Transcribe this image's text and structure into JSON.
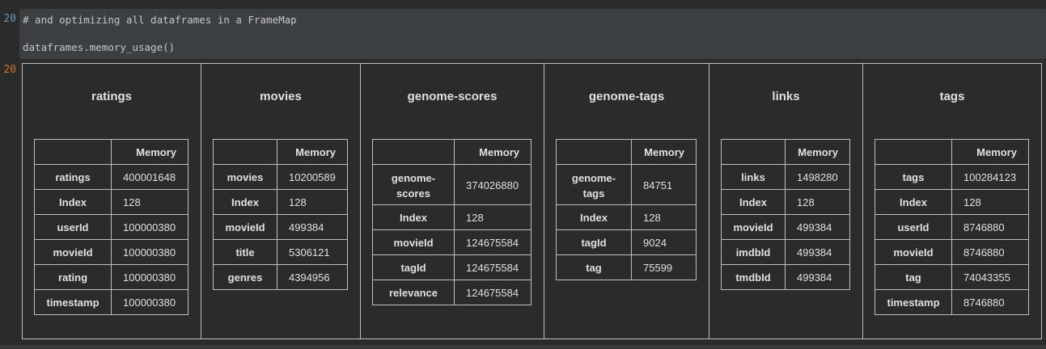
{
  "cell": {
    "in_prompt": "20",
    "out_prompt": "20",
    "code_lines": [
      "# and optimizing all dataframes in a FrameMap",
      "",
      "dataframes.memory_usage()"
    ]
  },
  "output": {
    "frames": [
      {
        "title": "ratings",
        "header": "Memory",
        "rows": [
          {
            "name": "ratings",
            "value": "400001648"
          },
          {
            "name": "Index",
            "value": "128"
          },
          {
            "name": "userId",
            "value": "100000380"
          },
          {
            "name": "movieId",
            "value": "100000380"
          },
          {
            "name": "rating",
            "value": "100000380"
          },
          {
            "name": "timestamp",
            "value": "100000380"
          }
        ]
      },
      {
        "title": "movies",
        "header": "Memory",
        "rows": [
          {
            "name": "movies",
            "value": "10200589"
          },
          {
            "name": "Index",
            "value": "128"
          },
          {
            "name": "movieId",
            "value": "499384"
          },
          {
            "name": "title",
            "value": "5306121"
          },
          {
            "name": "genres",
            "value": "4394956"
          }
        ]
      },
      {
        "title": "genome-scores",
        "header": "Memory",
        "rows": [
          {
            "name": "genome-scores",
            "value": "374026880"
          },
          {
            "name": "Index",
            "value": "128"
          },
          {
            "name": "movieId",
            "value": "124675584"
          },
          {
            "name": "tagId",
            "value": "124675584"
          },
          {
            "name": "relevance",
            "value": "124675584"
          }
        ]
      },
      {
        "title": "genome-tags",
        "header": "Memory",
        "rows": [
          {
            "name": "genome-tags",
            "value": "84751"
          },
          {
            "name": "Index",
            "value": "128"
          },
          {
            "name": "tagId",
            "value": "9024"
          },
          {
            "name": "tag",
            "value": "75599"
          }
        ]
      },
      {
        "title": "links",
        "header": "Memory",
        "rows": [
          {
            "name": "links",
            "value": "1498280"
          },
          {
            "name": "Index",
            "value": "128"
          },
          {
            "name": "movieId",
            "value": "499384"
          },
          {
            "name": "imdbId",
            "value": "499384"
          },
          {
            "name": "tmdbId",
            "value": "499384"
          }
        ]
      },
      {
        "title": "tags",
        "header": "Memory",
        "rows": [
          {
            "name": "tags",
            "value": "100284123"
          },
          {
            "name": "Index",
            "value": "128"
          },
          {
            "name": "userId",
            "value": "8746880"
          },
          {
            "name": "movieId",
            "value": "8746880"
          },
          {
            "name": "tag",
            "value": "74043355"
          },
          {
            "name": "timestamp",
            "value": "8746880"
          }
        ]
      }
    ]
  }
}
